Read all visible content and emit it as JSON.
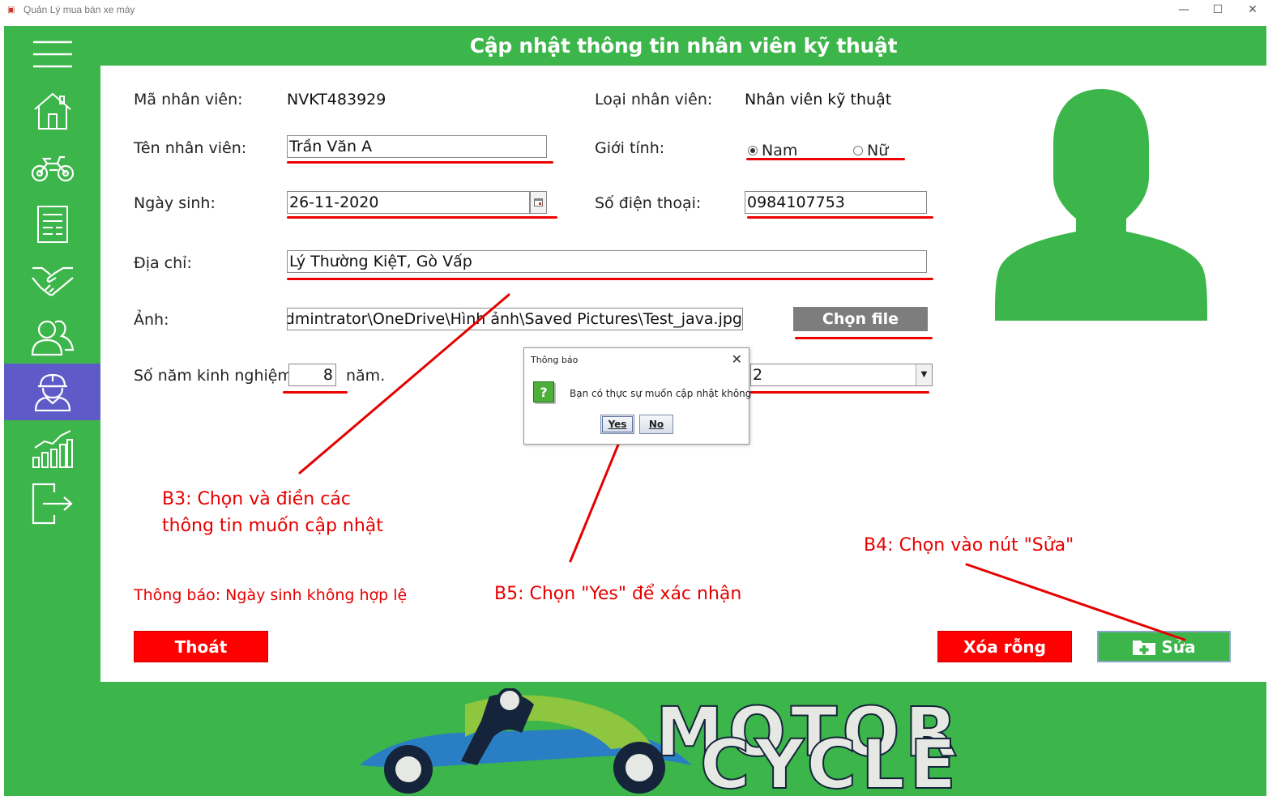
{
  "window": {
    "title": "Quản Lý mua bán xe máy",
    "controls": {
      "minimize": "—",
      "maximize": "☐",
      "close": "✕"
    }
  },
  "header": {
    "title": "Cập nhật thông tin nhân viên kỹ thuật"
  },
  "sidebar": {
    "items": [
      {
        "icon": "menu-icon"
      },
      {
        "icon": "home-icon"
      },
      {
        "icon": "motorbike-icon"
      },
      {
        "icon": "document-icon"
      },
      {
        "icon": "handshake-icon"
      },
      {
        "icon": "customers-icon"
      },
      {
        "icon": "technician-icon",
        "active": true
      },
      {
        "icon": "statistics-icon"
      },
      {
        "icon": "logout-icon"
      }
    ],
    "active_color": "#5e5bc8"
  },
  "form": {
    "employee_id_label": "Mã nhân viên:",
    "employee_id_value": "NVKT483929",
    "employee_type_label": "Loại nhân viên:",
    "employee_type_value": "Nhân viên kỹ thuật",
    "name_label": "Tên nhân viên:",
    "name_value": "Trần Văn A",
    "gender_label": "Giới tính:",
    "gender_options": [
      {
        "label": "Nam",
        "selected": true
      },
      {
        "label": "Nữ",
        "selected": false
      }
    ],
    "dob_label": "Ngày sinh:",
    "dob_value": "26-11-2020",
    "phone_label": "Số điện thoại:",
    "phone_value": "0984107753",
    "address_label": "Địa chỉ:",
    "address_value": "Lý Thường KiệT, Gò Vấp",
    "photo_label": "Ảnh:",
    "photo_value": "C:\\Users\\Admintrator\\OneDrive\\Hình ảnh\\Saved Pictures\\Test_java.jpg",
    "choose_file_label": "Chọn file",
    "experience_label": "Số năm kinh nghiệm:",
    "experience_value": "8",
    "experience_unit": "năm.",
    "level_value": "2",
    "status_message": "Thông báo: Ngày sinh không hợp lệ"
  },
  "buttons": {
    "exit_label": "Thoát",
    "clear_label": "Xóa rỗng",
    "edit_label": "Sửa"
  },
  "dialog": {
    "title": "Thông báo",
    "message": "Bạn có thực sự muốn cập nhật không",
    "icon": "?",
    "yes_label": "Yes",
    "no_label": "No"
  },
  "annotations": {
    "b3_line1": "B3: Chọn và điền các",
    "b3_line2": "thông tin muốn cập nhật",
    "b4": "B4: Chọn vào nút \"Sửa\"",
    "b5": "B5: Chọn \"Yes\" để xác nhận"
  },
  "banner": {
    "word1": "MOTOR",
    "word2": "CYCLE"
  },
  "colors": {
    "brand_green": "#3cb54a",
    "danger_red": "#ff0000",
    "annotation_red": "#e60000",
    "banner_navy": "#15243a"
  }
}
